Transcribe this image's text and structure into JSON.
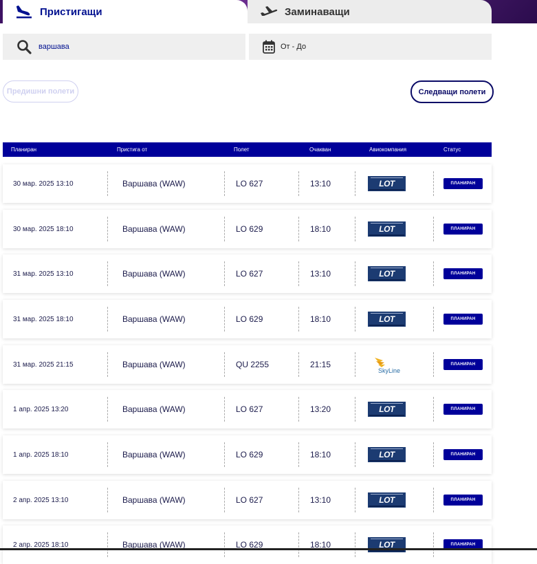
{
  "tabs": {
    "arrivals": "Пристигащи",
    "departures": "Заминаващи"
  },
  "search": {
    "value": "варшава",
    "date_placeholder": "От - До"
  },
  "buttons": {
    "previous": "Предишни полети",
    "next": "Следващи полети"
  },
  "table": {
    "headers": [
      "Планиран",
      "Пристига от",
      "Полет",
      "Очакван",
      "Авиокомпания",
      "Статус"
    ],
    "rows": [
      {
        "scheduled": "30 мар. 2025 13:10",
        "from": "Варшава (WAW)",
        "flight": "LO 627",
        "expected": "13:10",
        "airline": "LOT",
        "status": "ПЛАНИРАН"
      },
      {
        "scheduled": "30 мар. 2025 18:10",
        "from": "Варшава (WAW)",
        "flight": "LO 629",
        "expected": "18:10",
        "airline": "LOT",
        "status": "ПЛАНИРАН"
      },
      {
        "scheduled": "31 мар. 2025 13:10",
        "from": "Варшава (WAW)",
        "flight": "LO 627",
        "expected": "13:10",
        "airline": "LOT",
        "status": "ПЛАНИРАН"
      },
      {
        "scheduled": "31 мар. 2025 18:10",
        "from": "Варшава (WAW)",
        "flight": "LO 629",
        "expected": "18:10",
        "airline": "LOT",
        "status": "ПЛАНИРАН"
      },
      {
        "scheduled": "31 мар. 2025 21:15",
        "from": "Варшава (WAW)",
        "flight": "QU 2255",
        "expected": "21:15",
        "airline": "SkyLine",
        "status": "ПЛАНИРАН"
      },
      {
        "scheduled": "1 апр. 2025 13:20",
        "from": "Варшава (WAW)",
        "flight": "LO 627",
        "expected": "13:20",
        "airline": "LOT",
        "status": "ПЛАНИРАН"
      },
      {
        "scheduled": "1 апр. 2025 18:10",
        "from": "Варшава (WAW)",
        "flight": "LO 629",
        "expected": "18:10",
        "airline": "LOT",
        "status": "ПЛАНИРАН"
      },
      {
        "scheduled": "2 апр. 2025 13:10",
        "from": "Варшава (WAW)",
        "flight": "LO 627",
        "expected": "13:10",
        "airline": "LOT",
        "status": "ПЛАНИРАН"
      },
      {
        "scheduled": "2 апр. 2025 18:10",
        "from": "Варшава (WAW)",
        "flight": "LO 629",
        "expected": "18:10",
        "airline": "LOT",
        "status": "ПЛАНИРАН"
      }
    ]
  },
  "colors": {
    "primary": "#00009a",
    "navy_text": "#0a0a66",
    "lot_blue": "#1c3b72",
    "skyline_gold": "#f0b323"
  },
  "icons": [
    "arrival-plane-icon",
    "departure-plane-icon",
    "search-icon",
    "calendar-icon"
  ]
}
